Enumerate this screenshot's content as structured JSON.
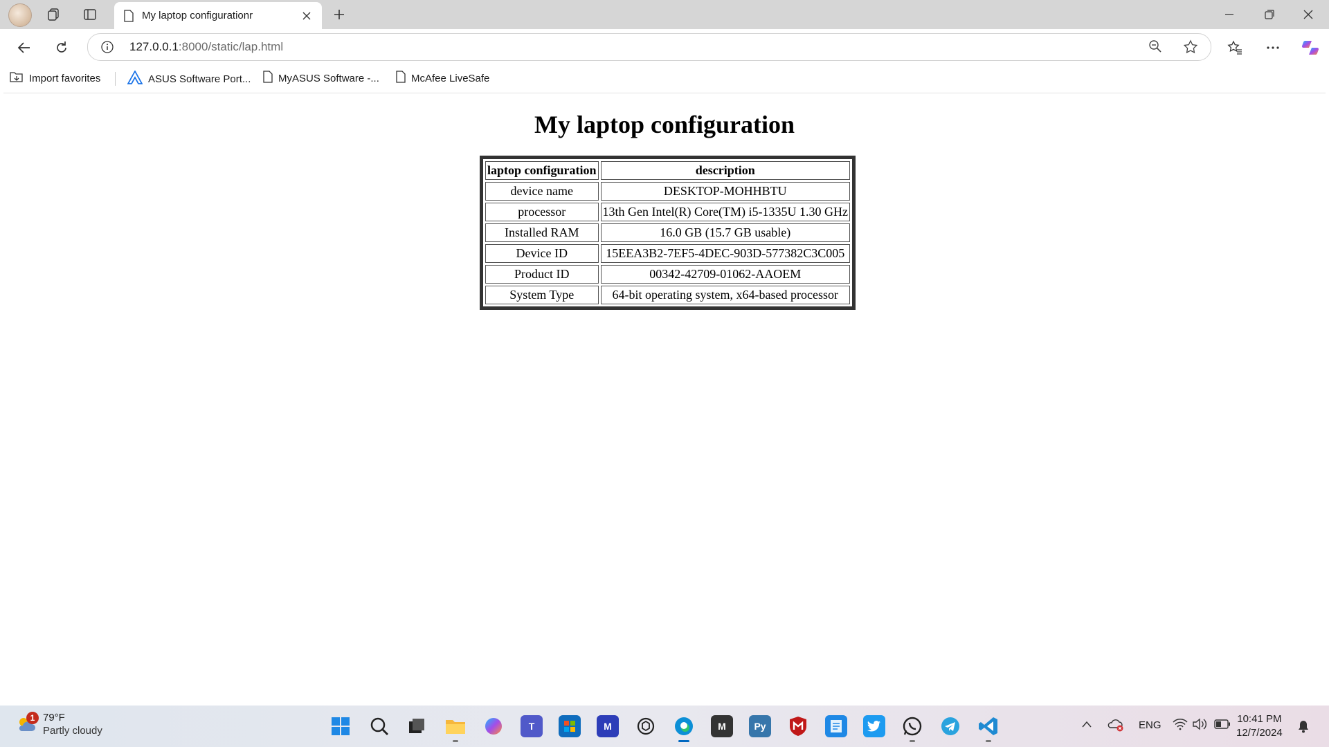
{
  "tab": {
    "title": "My laptop configurationr"
  },
  "address": {
    "host": "127.0.0.1",
    "path": ":8000/static/lap.html"
  },
  "favorites": [
    {
      "label": "Import favorites",
      "icon": "import-icon"
    },
    {
      "label": "ASUS Software Port...",
      "icon": "asus-icon"
    },
    {
      "label": "MyASUS Software -...",
      "icon": "page-icon"
    },
    {
      "label": "McAfee LiveSafe",
      "icon": "page-icon"
    }
  ],
  "page": {
    "title": "My laptop configuration",
    "table": {
      "headers": [
        "laptop configuration",
        "description"
      ],
      "rows": [
        [
          "device name",
          "DESKTOP-MOHHBTU"
        ],
        [
          "processor",
          "13th Gen Intel(R) Core(TM) i5-1335U 1.30 GHz"
        ],
        [
          "Installed RAM",
          "16.0 GB (15.7 GB usable)"
        ],
        [
          "Device ID",
          "15EEA3B2-7EF5-4DEC-903D-577382C3C005"
        ],
        [
          "Product ID",
          "00342-42709-01062-AAOEM"
        ],
        [
          "System Type",
          "64-bit operating system, x64-based processor"
        ]
      ]
    }
  },
  "taskbar": {
    "weather": {
      "temp": "79°F",
      "condition": "Partly cloudy",
      "badge": "1"
    },
    "tray": {
      "language": "ENG"
    },
    "clock": {
      "time": "10:41 PM",
      "date": "12/7/2024"
    }
  },
  "colors": {
    "accent": "#0067c0",
    "titlebar": "#d6d6d6"
  }
}
